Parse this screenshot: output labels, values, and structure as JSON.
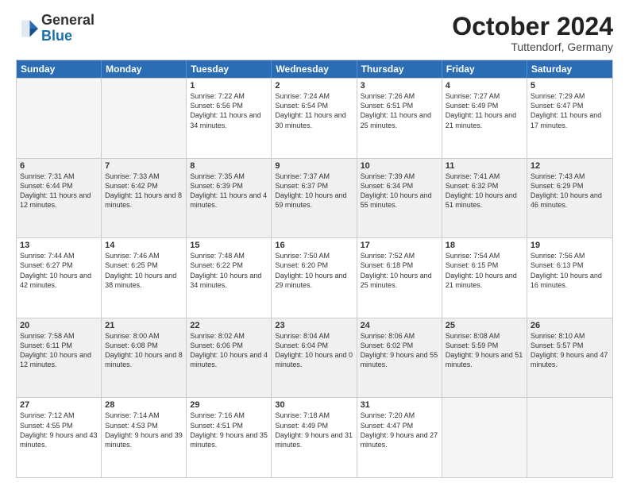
{
  "logo": {
    "general": "General",
    "blue": "Blue"
  },
  "header": {
    "month": "October 2024",
    "location": "Tuttendorf, Germany"
  },
  "weekdays": [
    "Sunday",
    "Monday",
    "Tuesday",
    "Wednesday",
    "Thursday",
    "Friday",
    "Saturday"
  ],
  "rows": [
    [
      {
        "day": "",
        "sunrise": "",
        "sunset": "",
        "daylight": "",
        "empty": true
      },
      {
        "day": "",
        "sunrise": "",
        "sunset": "",
        "daylight": "",
        "empty": true
      },
      {
        "day": "1",
        "sunrise": "Sunrise: 7:22 AM",
        "sunset": "Sunset: 6:56 PM",
        "daylight": "Daylight: 11 hours and 34 minutes.",
        "empty": false
      },
      {
        "day": "2",
        "sunrise": "Sunrise: 7:24 AM",
        "sunset": "Sunset: 6:54 PM",
        "daylight": "Daylight: 11 hours and 30 minutes.",
        "empty": false
      },
      {
        "day": "3",
        "sunrise": "Sunrise: 7:26 AM",
        "sunset": "Sunset: 6:51 PM",
        "daylight": "Daylight: 11 hours and 25 minutes.",
        "empty": false
      },
      {
        "day": "4",
        "sunrise": "Sunrise: 7:27 AM",
        "sunset": "Sunset: 6:49 PM",
        "daylight": "Daylight: 11 hours and 21 minutes.",
        "empty": false
      },
      {
        "day": "5",
        "sunrise": "Sunrise: 7:29 AM",
        "sunset": "Sunset: 6:47 PM",
        "daylight": "Daylight: 11 hours and 17 minutes.",
        "empty": false
      }
    ],
    [
      {
        "day": "6",
        "sunrise": "Sunrise: 7:31 AM",
        "sunset": "Sunset: 6:44 PM",
        "daylight": "Daylight: 11 hours and 12 minutes.",
        "empty": false
      },
      {
        "day": "7",
        "sunrise": "Sunrise: 7:33 AM",
        "sunset": "Sunset: 6:42 PM",
        "daylight": "Daylight: 11 hours and 8 minutes.",
        "empty": false
      },
      {
        "day": "8",
        "sunrise": "Sunrise: 7:35 AM",
        "sunset": "Sunset: 6:39 PM",
        "daylight": "Daylight: 11 hours and 4 minutes.",
        "empty": false
      },
      {
        "day": "9",
        "sunrise": "Sunrise: 7:37 AM",
        "sunset": "Sunset: 6:37 PM",
        "daylight": "Daylight: 10 hours and 59 minutes.",
        "empty": false
      },
      {
        "day": "10",
        "sunrise": "Sunrise: 7:39 AM",
        "sunset": "Sunset: 6:34 PM",
        "daylight": "Daylight: 10 hours and 55 minutes.",
        "empty": false
      },
      {
        "day": "11",
        "sunrise": "Sunrise: 7:41 AM",
        "sunset": "Sunset: 6:32 PM",
        "daylight": "Daylight: 10 hours and 51 minutes.",
        "empty": false
      },
      {
        "day": "12",
        "sunrise": "Sunrise: 7:43 AM",
        "sunset": "Sunset: 6:29 PM",
        "daylight": "Daylight: 10 hours and 46 minutes.",
        "empty": false
      }
    ],
    [
      {
        "day": "13",
        "sunrise": "Sunrise: 7:44 AM",
        "sunset": "Sunset: 6:27 PM",
        "daylight": "Daylight: 10 hours and 42 minutes.",
        "empty": false
      },
      {
        "day": "14",
        "sunrise": "Sunrise: 7:46 AM",
        "sunset": "Sunset: 6:25 PM",
        "daylight": "Daylight: 10 hours and 38 minutes.",
        "empty": false
      },
      {
        "day": "15",
        "sunrise": "Sunrise: 7:48 AM",
        "sunset": "Sunset: 6:22 PM",
        "daylight": "Daylight: 10 hours and 34 minutes.",
        "empty": false
      },
      {
        "day": "16",
        "sunrise": "Sunrise: 7:50 AM",
        "sunset": "Sunset: 6:20 PM",
        "daylight": "Daylight: 10 hours and 29 minutes.",
        "empty": false
      },
      {
        "day": "17",
        "sunrise": "Sunrise: 7:52 AM",
        "sunset": "Sunset: 6:18 PM",
        "daylight": "Daylight: 10 hours and 25 minutes.",
        "empty": false
      },
      {
        "day": "18",
        "sunrise": "Sunrise: 7:54 AM",
        "sunset": "Sunset: 6:15 PM",
        "daylight": "Daylight: 10 hours and 21 minutes.",
        "empty": false
      },
      {
        "day": "19",
        "sunrise": "Sunrise: 7:56 AM",
        "sunset": "Sunset: 6:13 PM",
        "daylight": "Daylight: 10 hours and 16 minutes.",
        "empty": false
      }
    ],
    [
      {
        "day": "20",
        "sunrise": "Sunrise: 7:58 AM",
        "sunset": "Sunset: 6:11 PM",
        "daylight": "Daylight: 10 hours and 12 minutes.",
        "empty": false
      },
      {
        "day": "21",
        "sunrise": "Sunrise: 8:00 AM",
        "sunset": "Sunset: 6:08 PM",
        "daylight": "Daylight: 10 hours and 8 minutes.",
        "empty": false
      },
      {
        "day": "22",
        "sunrise": "Sunrise: 8:02 AM",
        "sunset": "Sunset: 6:06 PM",
        "daylight": "Daylight: 10 hours and 4 minutes.",
        "empty": false
      },
      {
        "day": "23",
        "sunrise": "Sunrise: 8:04 AM",
        "sunset": "Sunset: 6:04 PM",
        "daylight": "Daylight: 10 hours and 0 minutes.",
        "empty": false
      },
      {
        "day": "24",
        "sunrise": "Sunrise: 8:06 AM",
        "sunset": "Sunset: 6:02 PM",
        "daylight": "Daylight: 9 hours and 55 minutes.",
        "empty": false
      },
      {
        "day": "25",
        "sunrise": "Sunrise: 8:08 AM",
        "sunset": "Sunset: 5:59 PM",
        "daylight": "Daylight: 9 hours and 51 minutes.",
        "empty": false
      },
      {
        "day": "26",
        "sunrise": "Sunrise: 8:10 AM",
        "sunset": "Sunset: 5:57 PM",
        "daylight": "Daylight: 9 hours and 47 minutes.",
        "empty": false
      }
    ],
    [
      {
        "day": "27",
        "sunrise": "Sunrise: 7:12 AM",
        "sunset": "Sunset: 4:55 PM",
        "daylight": "Daylight: 9 hours and 43 minutes.",
        "empty": false
      },
      {
        "day": "28",
        "sunrise": "Sunrise: 7:14 AM",
        "sunset": "Sunset: 4:53 PM",
        "daylight": "Daylight: 9 hours and 39 minutes.",
        "empty": false
      },
      {
        "day": "29",
        "sunrise": "Sunrise: 7:16 AM",
        "sunset": "Sunset: 4:51 PM",
        "daylight": "Daylight: 9 hours and 35 minutes.",
        "empty": false
      },
      {
        "day": "30",
        "sunrise": "Sunrise: 7:18 AM",
        "sunset": "Sunset: 4:49 PM",
        "daylight": "Daylight: 9 hours and 31 minutes.",
        "empty": false
      },
      {
        "day": "31",
        "sunrise": "Sunrise: 7:20 AM",
        "sunset": "Sunset: 4:47 PM",
        "daylight": "Daylight: 9 hours and 27 minutes.",
        "empty": false
      },
      {
        "day": "",
        "sunrise": "",
        "sunset": "",
        "daylight": "",
        "empty": true
      },
      {
        "day": "",
        "sunrise": "",
        "sunset": "",
        "daylight": "",
        "empty": true
      }
    ]
  ]
}
